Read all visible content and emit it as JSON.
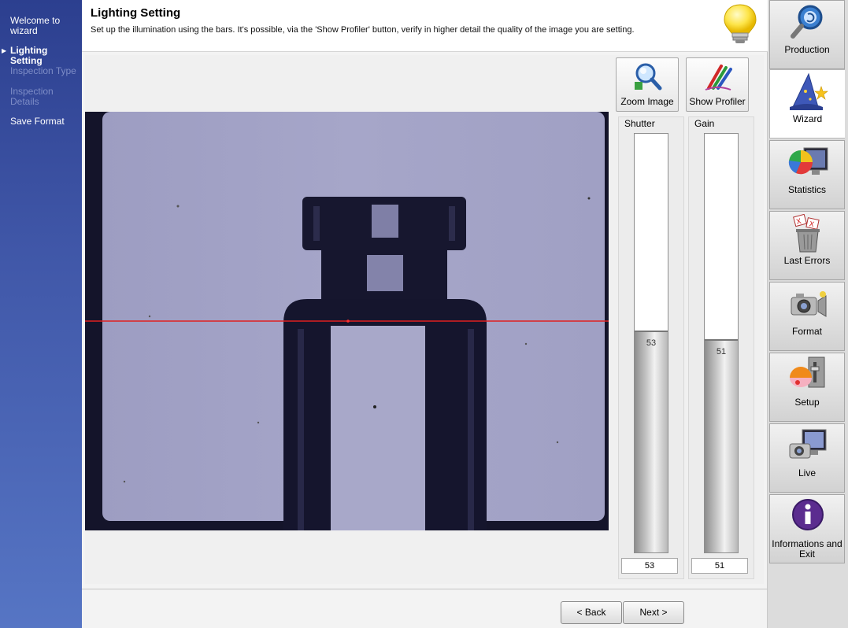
{
  "wizard_steps": [
    {
      "label": "Welcome to wizard",
      "state": "done"
    },
    {
      "label": "Lighting Setting",
      "state": "current"
    },
    {
      "label": "Inspection Type",
      "state": "disabled"
    },
    {
      "label": "Inspection Details",
      "state": "disabled"
    },
    {
      "label": "Save Format",
      "state": "done"
    }
  ],
  "header": {
    "title": "Lighting Setting",
    "subtitle": "Set up the illumination using the bars. It's possible, via the 'Show Profiler' button, verify in higher detail the quality of the image you are setting."
  },
  "toolbar": {
    "zoom_label": "Zoom Image",
    "profiler_label": "Show Profiler"
  },
  "bars": {
    "shutter": {
      "label": "Shutter",
      "value": "53",
      "level": 0.53
    },
    "gain": {
      "label": "Gain",
      "value": "51",
      "level": 0.51
    }
  },
  "navigation": {
    "back_label": "< Back",
    "next_label": "Next >"
  },
  "sidebar": [
    {
      "label": "Production",
      "icon": "magnifier-icon"
    },
    {
      "label": "Wizard",
      "icon": "wizard-hat-icon",
      "active": true
    },
    {
      "label": "Statistics",
      "icon": "pie-chart-monitor-icon"
    },
    {
      "label": "Last Errors",
      "icon": "trash-errors-icon"
    },
    {
      "label": "Format",
      "icon": "camera-format-icon"
    },
    {
      "label": "Setup",
      "icon": "setup-tools-icon"
    },
    {
      "label": "Live",
      "icon": "camera-live-icon"
    },
    {
      "label": "Informations and Exit",
      "icon": "info-icon"
    }
  ],
  "colors": {
    "accent": "#3c55a5",
    "profile_line": "#e02020",
    "image_background": "#a3a3c6",
    "bottle": "#161630"
  }
}
